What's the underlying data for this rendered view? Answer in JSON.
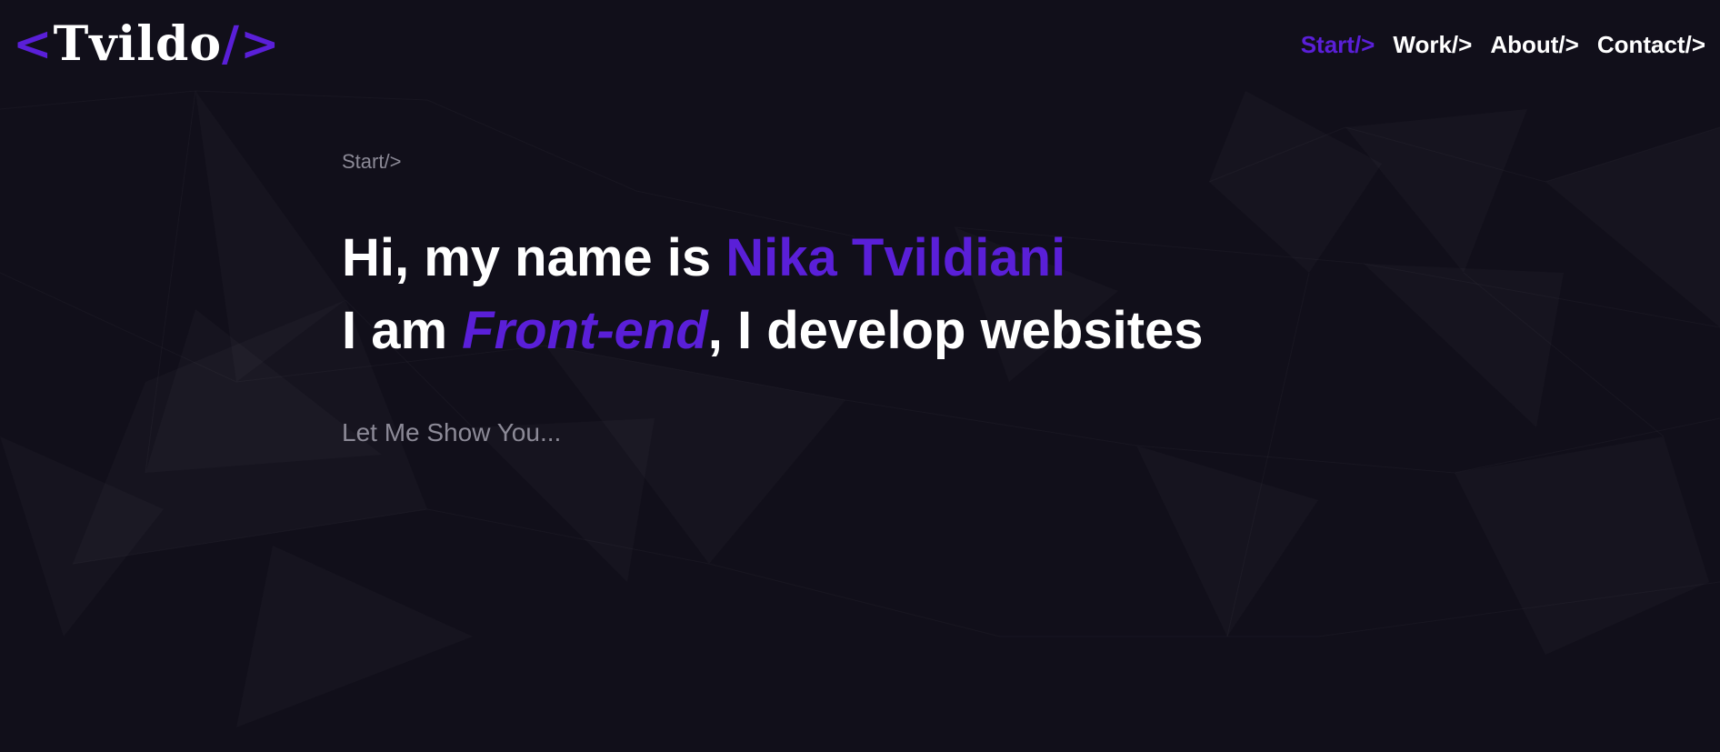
{
  "logo": {
    "open": "<",
    "name": "Tvildo",
    "close": "/>"
  },
  "nav": {
    "items": [
      {
        "label": "Start/>"
      },
      {
        "label": "Work/>"
      },
      {
        "label": "About/>"
      },
      {
        "label": "Contact/>"
      }
    ]
  },
  "hero": {
    "breadcrumb": "Start/>",
    "line1_prefix": "Hi, my name is ",
    "line1_name": "Nika Tvildiani",
    "line2_prefix": "I am ",
    "line2_role": "Front-end",
    "line2_suffix": ", I develop websites",
    "tagline": "Let Me Show You..."
  },
  "colors": {
    "background": "#110f1a",
    "accent": "#5a1fd8",
    "text": "#ffffff",
    "muted": "#8c8a97"
  }
}
